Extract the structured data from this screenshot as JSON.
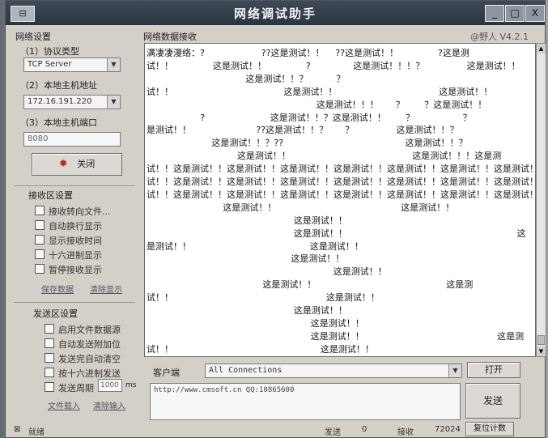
{
  "window": {
    "title": "网络调试助手",
    "icon_text": "⊟",
    "controls": {
      "minimize": "_",
      "maximize": "□",
      "close": "X"
    }
  },
  "network": {
    "group_title": "网络设置",
    "protocol_label": "（1）协议类型",
    "protocol_value": "TCP Server",
    "host_label": "（2）本地主机地址",
    "host_value": "172.16.191.220",
    "port_label": "（3）本地主机端口",
    "port_value": "8080",
    "close_button": "关闭"
  },
  "receive_settings": {
    "group_title": "接收区设置",
    "options": [
      "接收转向文件...",
      "自动换行显示",
      "显示接收时间",
      "十六进制显示",
      "暂停接收显示"
    ],
    "save_link": "保存数据",
    "clear_link": "清除显示"
  },
  "send_settings": {
    "group_title": "发送区设置",
    "options": [
      "启用文件数据源",
      "自动发送附加位",
      "发送完自动清空",
      "按十六进制发送"
    ],
    "interval_label": "发送周期",
    "interval_value": "1000",
    "interval_unit": "ms",
    "file_link": "文件载入",
    "clear_link": "清除输入"
  },
  "receive_area": {
    "title": "网络数据接收",
    "version": "@野人  V4.2.1",
    "lines": [
      {
        "row": 0,
        "text": "满凄凄漫络：?                    ??这是测试！！    ??这是测试！！              ?这是测"
      },
      {
        "row": 1,
        "text": "试！！              这是测试！！              ?               这是测试！！！？               这是测试！！"
      },
      {
        "row": 2,
        "text": "                                   这是测试！！？          ？                                                                    这是测"
      },
      {
        "row": 3,
        "text": "试！！                                       这是测试！！                                    这是测试！！"
      },
      {
        "row": 4,
        "text": "                                                            这是测试！！！      ？       ？这是测试！！"
      },
      {
        "row": 5,
        "text": "                   ?                       这是测试！！？这是测试！！       ？                 ？                          这"
      },
      {
        "row": 6,
        "text": "是测试！！                       ??这是测试！！？      ？               这是测试！！？"
      },
      {
        "row": 7,
        "text": "                       这是测试！！？??                                           这是测试！！？"
      },
      {
        "row": 8,
        "text": "                                这是测试！！                                           这是测试！！！这是测"
      },
      {
        "row": 9,
        "text": "试！！这是测试！！这是测试！！这是测试！！这是测试！！这是测试！！这是测试！！这是测试！！"
      },
      {
        "row": 10,
        "text": "试！！这是测试！！这是测试！！这是测试！！这是测试！！这是测试！！这是测试！！这是测试！！"
      },
      {
        "row": 11,
        "text": "试！！这是测试！！这是测试！！这是测试！！这是测试！！这是测试！！这是测试！！这是测试！"
      },
      {
        "row": 12,
        "text": "                           这是测试！！                                            这是测试！！"
      },
      {
        "row": 13,
        "text": "                                                    这是测试！！"
      },
      {
        "row": 14,
        "text": "                                                    这是测试！！                                                            这"
      },
      {
        "row": 15,
        "text": "是测试！！                                          这是测试！！"
      },
      {
        "row": 16,
        "text": "                                                   这是测试！！"
      },
      {
        "row": 17,
        "text": "                                                                  这是测试！！"
      },
      {
        "row": 18,
        "text": "                                         这是测试！！                                              这是测"
      },
      {
        "row": 19,
        "text": "试！！                                                      这是测试！！"
      },
      {
        "row": 20,
        "text": "                                                    这是测试！！"
      },
      {
        "row": 21,
        "text": "                                                          这是测试！！"
      },
      {
        "row": 22,
        "text": "                                                          这是测试！！                                               这是测"
      },
      {
        "row": 23,
        "text": "试！！                                                    这是测试！！"
      }
    ]
  },
  "client": {
    "label": "客户端",
    "value": "All Connections",
    "open_button": "打开"
  },
  "send_area": {
    "text": "http://www.cmsoft.cn QQ:10865600",
    "send_button": "发送"
  },
  "status_bar": {
    "ready": "就绪",
    "send_label": "发送",
    "send_count": "0",
    "recv_label": "接收",
    "recv_count": "72024",
    "reset_button": "复位计数"
  }
}
